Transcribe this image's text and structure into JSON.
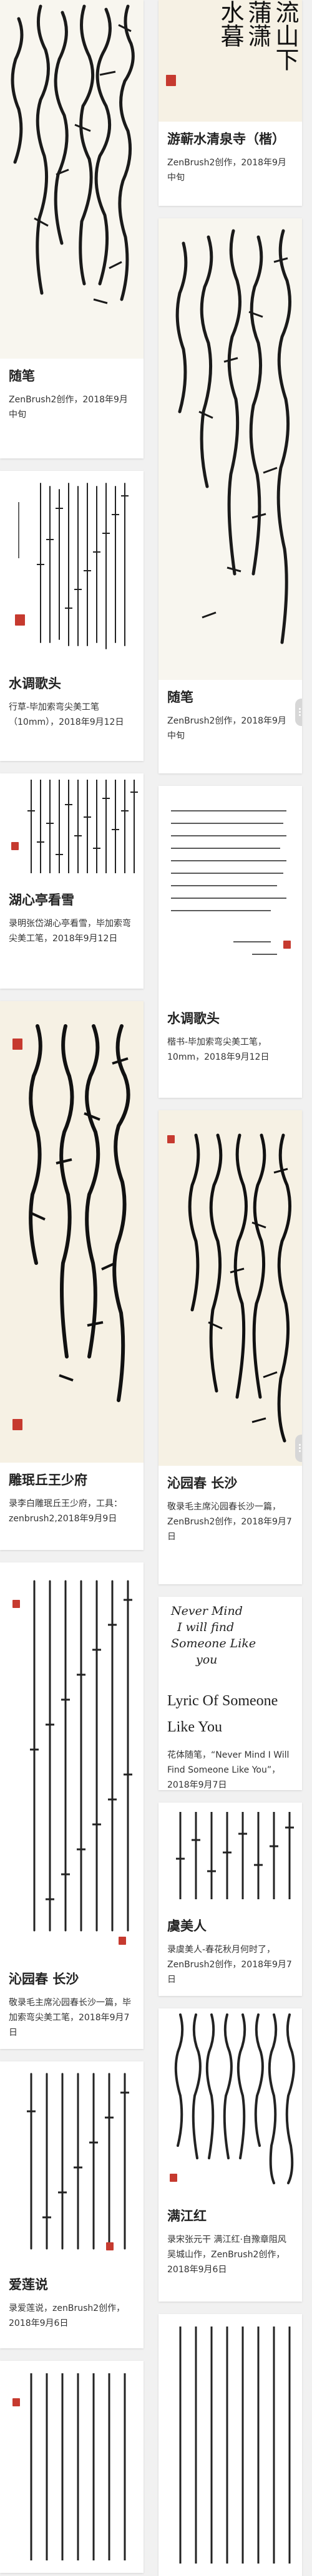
{
  "cards_left": [
    {
      "title": "随笔",
      "desc": "ZenBrush2创作，2018年9月中旬"
    },
    {
      "title": "水调歌头",
      "desc": "行草-毕加索弯尖美工笔（10mm），2018年9月12日"
    },
    {
      "title": "湖心亭看雪",
      "desc": "录明张岱湖心亭看雪，毕加索弯尖美工笔，2018年9月12日"
    },
    {
      "title": "雕珉丘王少府",
      "desc": "录李白雕珉丘王少府，工具：zenbrush2,2018年9月9日"
    },
    {
      "title": "沁园春 长沙",
      "desc": "敬录毛主席沁园春长沙一篇，毕加索弯尖美工笔，2018年9月7日"
    },
    {
      "title": "爱莲说",
      "desc": "录爱莲说，zenBrush2创作，2018年9月6日"
    }
  ],
  "cards_right": [
    {
      "title": "游蕲水清泉寺（楷）",
      "desc": "ZenBrush2创作，2018年9月中旬",
      "thumb_glyphs": [
        "流山下",
        "蒲潇",
        "水暮"
      ]
    },
    {
      "title": "随笔",
      "desc": "ZenBrush2创作，2018年9月中旬"
    },
    {
      "title": "水调歌头",
      "desc": "楷书-毕加索弯尖美工笔，10mm，2018年9月12日"
    },
    {
      "title": "沁园春 长沙",
      "desc": "敬录毛主席沁园春长沙一篇，ZenBrush2创作，2018年9月7日"
    },
    {
      "title": "Lyric Of Someone Like You",
      "desc": "花体随笔，“Never Mind I Will Find Someone Like You”，2018年9月7日",
      "thumb_text": [
        "Never Mind",
        "I will find",
        "Someone Like",
        "you"
      ]
    },
    {
      "title": "虞美人",
      "desc": "录虞美人-春花秋月何时了，ZenBrush2创作，2018年9月7日"
    },
    {
      "title": "满江红",
      "desc": "录宋张元干 满江红·自豫章阻风吴城山作，ZenBrush2创作，2018年9月6日"
    }
  ]
}
